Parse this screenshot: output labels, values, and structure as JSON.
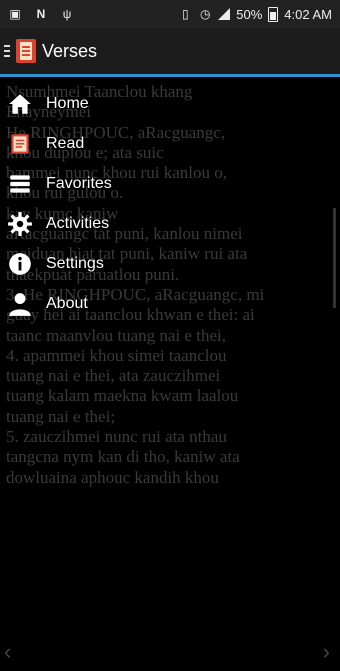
{
  "status_bar": {
    "battery": "50%",
    "time": "4:02 AM"
  },
  "app_bar": {
    "title": "Verses"
  },
  "content": {
    "text": "Nsumhmei Taanclou khang\nEnayneymei\nHe RINGHPOUC, aRacguangc,\nkhou duplou e; ata suic\nbammei nunc khou rui kanlou o,\nkhou rui gulou o.\nkay kumc kaniw\naRacguangc tat puni, kanlou nimei\nmeiduan hiat tat puni, kaniw rui ata\nthaekpuat paruatlou puni.\n3. He RINGHPOUC, aRacguangc, mi\nguay hei ai taanclou khwan e thei: ai\ntaanc maanvlou tuang nai e thei,\n4. apammei khou simei taanclou\ntuang nai e thei, ata zauczihmei\ntuang kalam maekna kwam laalou\ntuang nai e thei;\n5. zauczihmei nunc rui ata nthau\ntangcna nym kan di tho, kaniw ata\ndowluaina aphouc kandih khou"
  },
  "drawer": {
    "items": [
      {
        "label": "Home",
        "icon": "home-icon"
      },
      {
        "label": "Read",
        "icon": "read-icon"
      },
      {
        "label": "Favorites",
        "icon": "favorites-icon"
      },
      {
        "label": "Activities",
        "icon": "gear-icon"
      },
      {
        "label": "Settings",
        "icon": "info-icon"
      },
      {
        "label": "About",
        "icon": "person-icon"
      }
    ]
  },
  "nav": {
    "prev": "‹",
    "next": "›"
  },
  "colors": {
    "accent": "#2e95d3",
    "logo": "#d9432f"
  }
}
